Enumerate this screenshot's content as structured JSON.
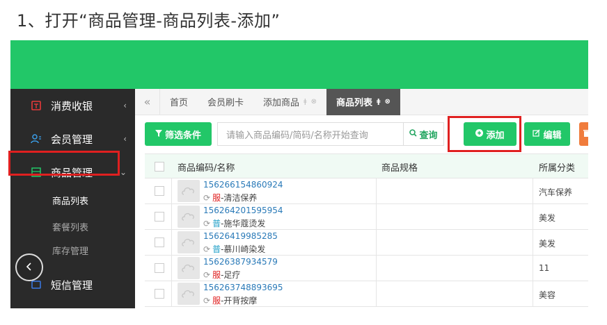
{
  "heading": "1、打开“商品管理-商品列表-添加”",
  "colors": {
    "brand_green": "#22c768",
    "sidebar_bg": "#2a2a2a",
    "highlight_red": "#e02020",
    "delete_orange": "#f07c3c"
  },
  "sidebar": {
    "items": [
      {
        "label": "消费收银",
        "icon": "receipt-icon",
        "arrow": "‹"
      },
      {
        "label": "会员管理",
        "icon": "member-icon",
        "arrow": "‹"
      },
      {
        "label": "商品管理",
        "icon": "box-icon",
        "arrow": "⌄"
      },
      {
        "label": "短信管理",
        "icon": "sms-icon"
      }
    ],
    "subitems": [
      {
        "label": "商品列表"
      },
      {
        "label": "套餐列表"
      },
      {
        "label": "库存管理"
      }
    ]
  },
  "tabs": {
    "nav_icon": "«",
    "items": [
      {
        "label": "首页"
      },
      {
        "label": "会员刷卡"
      },
      {
        "label": "添加商品",
        "mini": "⊗"
      },
      {
        "label": "商品列表",
        "mini": "⊗"
      }
    ]
  },
  "toolbar": {
    "filter_label": "筛选条件",
    "search_placeholder": "请输入商品编码/简码/名称开始查询",
    "query_label": "查询",
    "add_label": "添加",
    "edit_label": "编辑"
  },
  "table": {
    "headers": {
      "code": "商品编码/名称",
      "spec": "商品规格",
      "category": "所属分类"
    },
    "rows": [
      {
        "code": "156266154860924",
        "tag": "服",
        "tag_color": "red",
        "name": "-清洁保养",
        "spec": "",
        "category": "汽车保养"
      },
      {
        "code": "156264201595954",
        "tag": "普",
        "tag_color": "blue",
        "name": "-施华蔻烫发",
        "spec": "",
        "category": "美发"
      },
      {
        "code": "15626419985285",
        "tag": "普",
        "tag_color": "blue",
        "name": "-慕川崎染发",
        "spec": "",
        "category": "美发"
      },
      {
        "code": "15626387934579",
        "tag": "服",
        "tag_color": "red",
        "name": "-足疗",
        "spec": "",
        "category": "11"
      },
      {
        "code": "156263748893695",
        "tag": "服",
        "tag_color": "red",
        "name": "-开背按摩",
        "spec": "",
        "category": "美容"
      }
    ]
  }
}
